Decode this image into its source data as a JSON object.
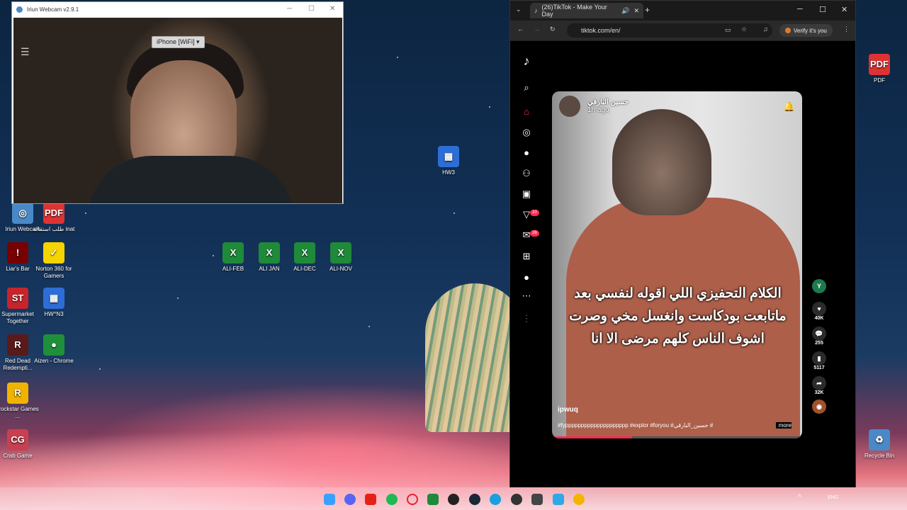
{
  "webcam": {
    "title": "Iriun Webcam v2.9.1",
    "device": "iPhone [WiFi]"
  },
  "desktop": {
    "icons": [
      {
        "label": "Iriun Webcam",
        "color": "#4a89c7",
        "glyph": "◎"
      },
      {
        "label": "طلب استقالة inat",
        "color": "#d33",
        "glyph": "PDF"
      },
      {
        "label": "Liar's Bar",
        "color": "#700",
        "glyph": "!"
      },
      {
        "label": "Norton 360 for Gamers",
        "color": "#f5d400",
        "glyph": "✓"
      },
      {
        "label": "Supermarket Together",
        "color": "#c8242c",
        "glyph": "ST"
      },
      {
        "label": "HW^N3",
        "color": "#2d6ed6",
        "glyph": "▦"
      },
      {
        "label": "Red Dead Redempti...",
        "color": "#5a1a1a",
        "glyph": "R"
      },
      {
        "label": "Aizen - Chrome",
        "color": "#1f8f3b",
        "glyph": "●"
      },
      {
        "label": "Rockstar Games ...",
        "color": "#f0b400",
        "glyph": "R"
      },
      {
        "label": "Crab Game",
        "color": "#c84050",
        "glyph": "CG"
      },
      {
        "label": "HW3",
        "color": "#2d6ed6",
        "glyph": "▦"
      },
      {
        "label": "ALI-FEB",
        "color": "#1e8a3a",
        "glyph": "X"
      },
      {
        "label": "ALI JAN",
        "color": "#1e8a3a",
        "glyph": "X"
      },
      {
        "label": "ALI-DEC",
        "color": "#1e8a3a",
        "glyph": "X"
      },
      {
        "label": "ALI-NOV",
        "color": "#1e8a3a",
        "glyph": "X"
      },
      {
        "label": "PDF",
        "color": "#d33",
        "glyph": "PDF"
      },
      {
        "label": "Recycle Bin",
        "color": "#4a89c7",
        "glyph": "♻"
      }
    ]
  },
  "browser": {
    "tab_title": "(26)TikTok - Make Your Day",
    "url": "tiktok.com/en/",
    "verify": "Verify it's you"
  },
  "tiktok": {
    "author": "حسين البارقي",
    "time": "1h ago",
    "caption": "الكلام التحفيزي اللي اقوله لنفسي بعد ماتابعت بودكاست وانغسل مخي وصرت اشوف الناس كلهم مرضى الا انا",
    "handle": "ipwuq",
    "tags": "#fypppppppppppppppppppp #explor #foryou #حسين_البارقي #",
    "more": "more",
    "progress": 0.32,
    "likes": "40K",
    "comments": "255",
    "saves": "5117",
    "shares": "32K",
    "nav_badges": {
      "activity": "10",
      "messages": "26"
    }
  },
  "taskbar": {
    "lang": "ENG"
  }
}
